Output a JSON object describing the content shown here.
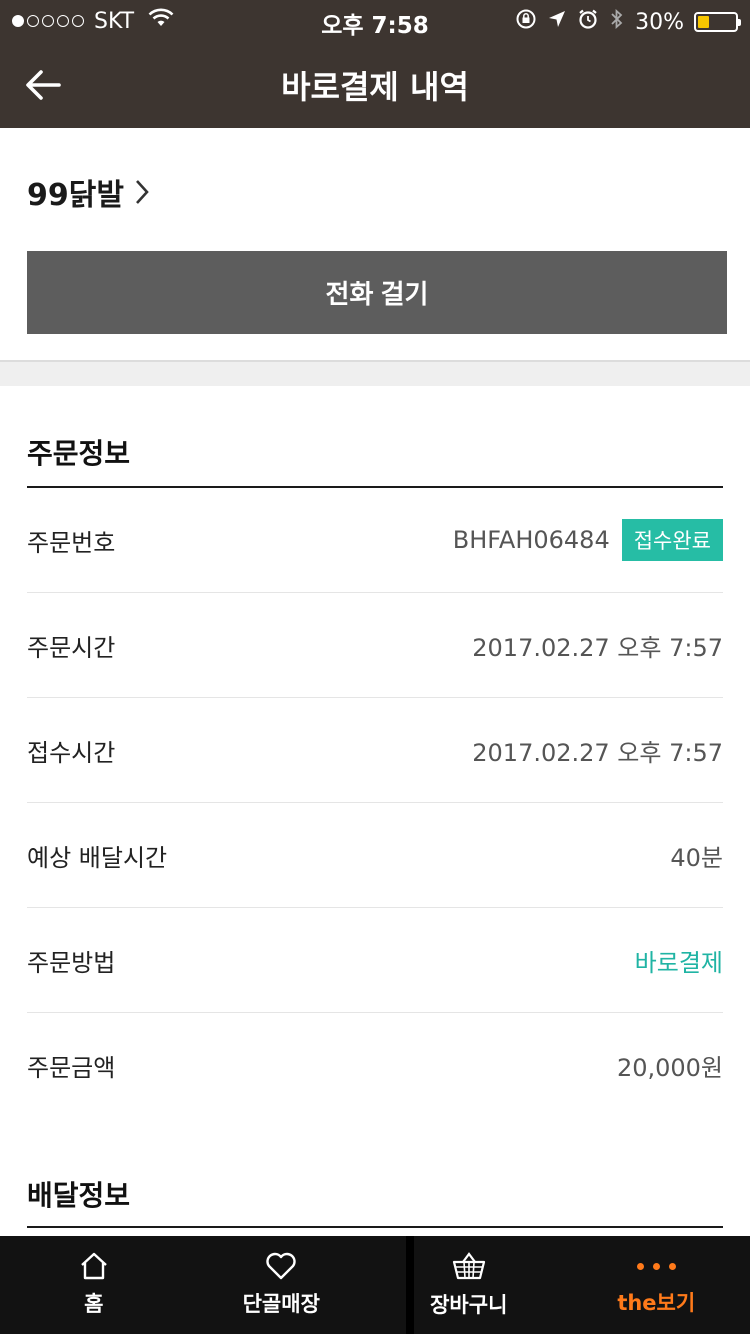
{
  "status_bar": {
    "carrier": "SKT",
    "time": "오후 7:58",
    "battery": "30%",
    "battery_level": 0.3
  },
  "header": {
    "title": "바로결제 내역"
  },
  "store": {
    "name": "99닭발",
    "call_label": "전화 걸기"
  },
  "order_info": {
    "title": "주문정보",
    "rows": [
      {
        "label": "주문번호",
        "value": "BHFAH06484",
        "badge": "접수완료"
      },
      {
        "label": "주문시간",
        "value": "2017.02.27 오후 7:57"
      },
      {
        "label": "접수시간",
        "value": "2017.02.27 오후 7:57"
      },
      {
        "label": "예상 배달시간",
        "value": "40분"
      },
      {
        "label": "주문방법",
        "value": "바로결제"
      },
      {
        "label": "주문금액",
        "value": "20,000원"
      }
    ]
  },
  "delivery_info": {
    "title": "배달정보"
  },
  "tabbar": {
    "items": [
      {
        "label": "홈",
        "icon": "home-icon"
      },
      {
        "label": "단골매장",
        "icon": "heart-icon"
      },
      {
        "label": "장바구니",
        "icon": "basket-icon"
      },
      {
        "label": "the보기",
        "icon": "more-dots-icon",
        "active": true
      }
    ]
  },
  "colors": {
    "header_bg": "#3d3530",
    "accent_teal": "#26bda5",
    "active_tab": "#ff7a1a",
    "call_button": "#5d5d5d"
  }
}
